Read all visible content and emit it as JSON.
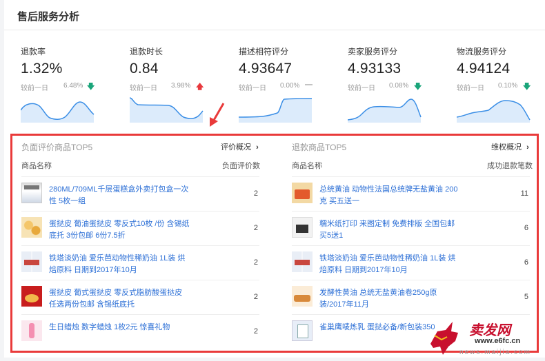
{
  "page": {
    "title": "售后服务分析"
  },
  "metrics": [
    {
      "label": "退款率",
      "value": "1.32%",
      "compare_label": "较前一日",
      "change": "6.48%",
      "trend": "down",
      "arrow": "🡇"
    },
    {
      "label": "退款时长",
      "value": "0.84",
      "compare_label": "较前一日",
      "change": "3.98%",
      "trend": "up",
      "arrow": "🡅"
    },
    {
      "label": "描述相符评分",
      "value": "4.93647",
      "compare_label": "较前一日",
      "change": "0.00%",
      "trend": "flat",
      "arrow": "—"
    },
    {
      "label": "卖家服务评分",
      "value": "4.93133",
      "compare_label": "较前一日",
      "change": "0.08%",
      "trend": "down",
      "arrow": "🡇"
    },
    {
      "label": "物流服务评分",
      "value": "4.94124",
      "compare_label": "较前一日",
      "change": "0.10%",
      "trend": "down",
      "arrow": "🡇"
    }
  ],
  "negative_top5": {
    "title": "负面评价商品TOP5",
    "link": "评价概况",
    "col_name": "商品名称",
    "col_count": "负面评价数",
    "rows": [
      {
        "name": "280ML/709ML千层蛋糕盒外卖打包盒一次性 5枚一组",
        "count": "2"
      },
      {
        "name": "蛋挞皮 葡油蛋挞皮 零反式10枚 /份 含锡纸底托 3份包邮 6份7.5折",
        "count": "2"
      },
      {
        "name": "铁塔淡奶油 爱乐芭动物性稀奶油 1L装 烘焙原料 日期到2017年10月",
        "count": "2"
      },
      {
        "name": "蛋挞皮 葡式蛋挞皮 零反式脂肪酸蛋挞皮 任选两份包邮 含锡纸底托",
        "count": "2"
      },
      {
        "name": "生日蜡烛 数字蜡烛 1枚2元 惊喜礼物",
        "count": "2"
      }
    ]
  },
  "refund_top5": {
    "title": "退款商品TOP5",
    "link": "维权概况",
    "col_name": "商品名称",
    "col_count": "成功退款笔数",
    "rows": [
      {
        "name": "总统黄油 动物性法国总统牌无盐黄油 200克 买五送一",
        "count": "11"
      },
      {
        "name": "糯米纸打印 来图定制 免费排版 全国包邮 买5送1",
        "count": "6"
      },
      {
        "name": "铁塔淡奶油 爱乐芭动物性稀奶油 1L装 烘焙原料 日期到2017年10月",
        "count": "6"
      },
      {
        "name": "发酵性黄油 总统无盐黄油卷250g原装/2017年11月",
        "count": "5"
      },
      {
        "name": "雀巢鹰唛炼乳 蛋挞必备/新包装350",
        "count": ""
      }
    ]
  },
  "watermark": {
    "brand": "卖发网",
    "url": "www.e6fc.cn",
    "sub": "news.maijia.com"
  },
  "colors": {
    "accent_red": "#e93a3a",
    "link_blue": "#2c6fd6",
    "chart_blue": "#3a8ee6",
    "up": "#e8383d",
    "down": "#1aa57a"
  }
}
